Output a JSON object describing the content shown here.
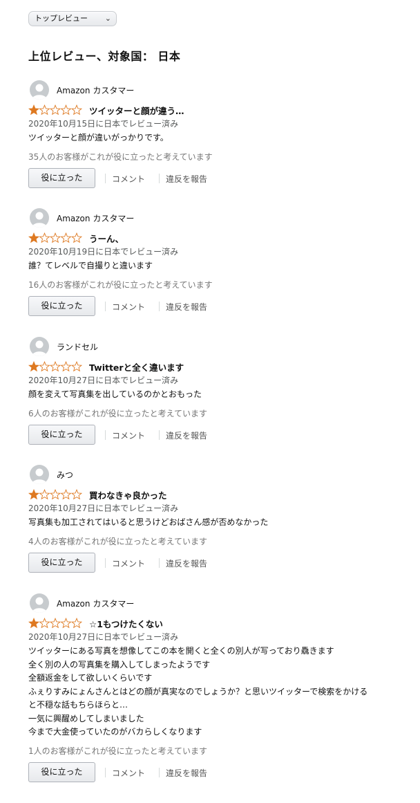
{
  "sort": {
    "selected": "トップレビュー"
  },
  "section_title": "上位レビュー、対象国： 日本",
  "colors": {
    "star": "#de7921",
    "star_empty_stroke": "#de7921",
    "helpful_text": "#767676"
  },
  "actions": {
    "helpful_label": "役に立った",
    "comment_label": "コメント",
    "report_label": "違反を報告"
  },
  "reviews": [
    {
      "author": "Amazon カスタマー",
      "rating": 1,
      "title": "ツイッターと顔が違う…",
      "date": "2020年10月15日に日本でレビュー済み",
      "body": [
        "ツイッターと顔が違いがっかりです。"
      ],
      "helpful": "35人のお客様がこれが役に立ったと考えています"
    },
    {
      "author": "Amazon カスタマー",
      "rating": 1,
      "title": "うーん、",
      "date": "2020年10月19日に日本でレビュー済み",
      "body": [
        "誰？てレベルで自撮りと違います"
      ],
      "helpful": "16人のお客様がこれが役に立ったと考えています"
    },
    {
      "author": "ランドセル",
      "rating": 1,
      "title": "Twitterと全く違います",
      "date": "2020年10月27日に日本でレビュー済み",
      "body": [
        "顔を変えて写真集を出しているのかとおもった"
      ],
      "helpful": "6人のお客様がこれが役に立ったと考えています"
    },
    {
      "author": "みつ",
      "rating": 1,
      "title": "買わなきゃ良かった",
      "date": "2020年10月27日に日本でレビュー済み",
      "body": [
        "写真集も加工されてはいると思うけどおばさん感が否めなかった"
      ],
      "helpful": "4人のお客様がこれが役に立ったと考えています"
    },
    {
      "author": "Amazon カスタマー",
      "rating": 1,
      "title": "☆1もつけたくない",
      "date": "2020年10月27日に日本でレビュー済み",
      "body": [
        "ツイッターにある写真を想像してこの本を開くと全くの別人が写っており驫きます",
        "全く別の人の写真集を購入してしまったようです",
        "全額返金をして欲しいくらいです",
        "ふぇりすみにょんさんとはどの顔が真実なのでしょうか？と思いツイッターで検索をかける",
        "と不穏な話もちらほらと…",
        "一気に興醒めしてしまいました",
        "今まで大金使っていたのがバカらしくなります"
      ],
      "helpful": "1人のお客様がこれが役に立ったと考えています"
    }
  ]
}
